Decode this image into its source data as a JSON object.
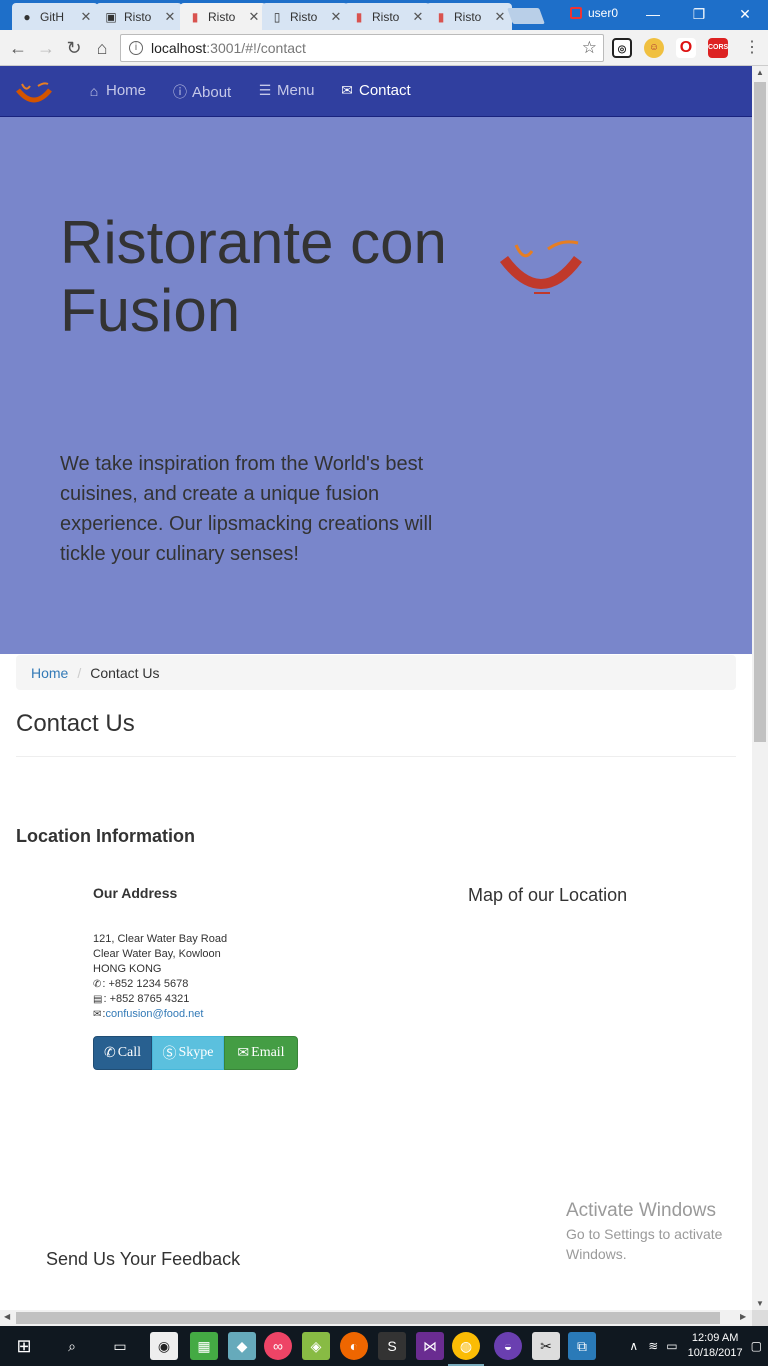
{
  "browser": {
    "tabs": [
      {
        "title": "GitH",
        "icon": "github-icon",
        "active": false
      },
      {
        "title": "Risto",
        "icon": "page-icon",
        "active": false
      },
      {
        "title": "Risto",
        "icon": "risto-icon",
        "active": true
      },
      {
        "title": "Risto",
        "icon": "doc-icon",
        "active": false
      },
      {
        "title": "Risto",
        "icon": "risto-icon",
        "active": false
      },
      {
        "title": "Risto",
        "icon": "risto-icon",
        "active": false
      }
    ],
    "user": "user0",
    "url_host": "localhost",
    "url_rest": ":3001/#!/contact"
  },
  "navbar": {
    "items": [
      {
        "label": "Home",
        "icon": "home-icon"
      },
      {
        "label": "About",
        "icon": "info-icon"
      },
      {
        "label": "Menu",
        "icon": "list-icon"
      },
      {
        "label": "Contact",
        "icon": "envelope-icon",
        "active": true
      }
    ]
  },
  "jumbotron": {
    "title": "Ristorante con Fusion",
    "tagline": "We take inspiration from the World's best cuisines, and create a unique fusion experience. Our lipsmacking creations will tickle your culinary senses!"
  },
  "breadcrumb": {
    "home": "Home",
    "current": "Contact Us"
  },
  "page": {
    "title": "Contact Us",
    "location_heading": "Location Information",
    "address_heading": "Our Address",
    "address_lines": [
      "121, Clear Water Bay Road",
      "Clear Water Bay, Kowloon",
      "HONG KONG"
    ],
    "phone": ": +852 1234 5678",
    "fax": ": +852 8765 4321",
    "email_prefix": ": ",
    "email": "confusion@food.net",
    "map_heading": "Map of our Location",
    "feedback_heading": "Send Us Your Feedback"
  },
  "buttons": {
    "call": "Call",
    "skype": "Skype",
    "email": "Email"
  },
  "watermark": {
    "title": "Activate Windows",
    "line1": "Go to Settings to activate",
    "line2": "Windows."
  },
  "taskbar": {
    "time": "12:09 AM",
    "date": "10/18/2017"
  },
  "colors": {
    "navbar": "#303f9f",
    "jumbotron": "#7986cb",
    "call_button": "#286090",
    "skype_button": "#5bc0de",
    "email_button": "#449d44"
  }
}
